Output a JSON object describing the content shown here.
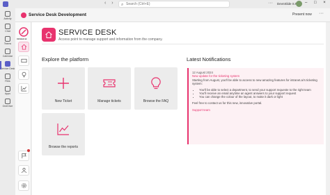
{
  "teams": {
    "search_placeholder": "Search (Ctrl+E)",
    "org_label": "DevnSlide S.R.L.",
    "window_controls": "– □ ×",
    "more_label": "···",
    "rail": [
      {
        "label": "Activity",
        "icon": "bell-icon"
      },
      {
        "label": "Chat",
        "icon": "chat-icon"
      },
      {
        "label": "Teams",
        "icon": "teams-icon"
      },
      {
        "label": "Calendar",
        "icon": "calendar-icon"
      },
      {
        "label": "Service Desk",
        "icon": "service-desk-icon",
        "active": true
      },
      {
        "label": "Files",
        "icon": "files-icon"
      },
      {
        "label": "Apps",
        "icon": "apps-icon"
      },
      {
        "label": "OneDrive",
        "icon": "onedrive-icon"
      }
    ]
  },
  "appbar": {
    "title": "Service Desk Development",
    "present_label": "Present now",
    "more_label": "···"
  },
  "leftnav": {
    "brand_text": "intranet.ai",
    "items": [
      "home-icon",
      "ticket-icon",
      "bulb-icon",
      "chart-icon",
      "flag-icon",
      "person-icon",
      "settings-icon"
    ]
  },
  "hero": {
    "title": "SERVICE DESK",
    "subtitle": "Access point to manage support and information from the company."
  },
  "explore": {
    "title": "Explore the platform",
    "tiles": [
      {
        "label": "New Ticket",
        "icon": "plus-icon"
      },
      {
        "label": "Manage tickets",
        "icon": "ticket-icon"
      },
      {
        "label": "Browse the FAQ",
        "icon": "lightbulb-icon"
      },
      {
        "label": "Browse the reports",
        "icon": "chart-line-icon"
      }
    ]
  },
  "notifications": {
    "title": "Latest Notifications",
    "date": "12 August 2024",
    "headline": "New update for the ticketing system",
    "intro": "Starting from August, you'll be able to access to new amazing features for intranet.ai's ticketing system:",
    "bullets": [
      "You'll be able to select a department, to send your support requeste to the right team",
      "You'll receive an email anytime an agent answers to your support request",
      "You can change the colour of the layout, to make it dark or light"
    ],
    "outro": "Feel free to contact us for this new, innovative portal.",
    "signature": "Support team"
  },
  "colors": {
    "accent": "#e8336e",
    "teams": "#5b5fc7"
  }
}
